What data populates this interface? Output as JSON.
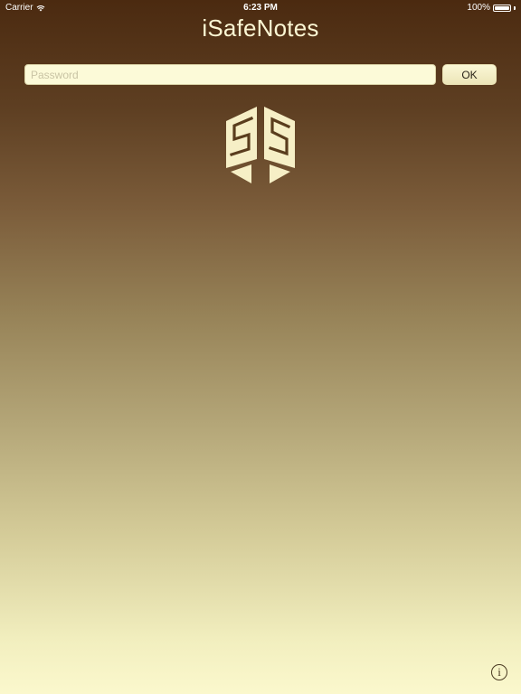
{
  "status_bar": {
    "carrier": "Carrier",
    "time": "6:23 PM",
    "battery_percent": "100%",
    "battery_level": 1.0,
    "wifi_icon": "wifi-icon",
    "battery_icon": "battery-icon"
  },
  "app": {
    "title": "iSafeNotes",
    "logo_icon": "isafenotes-logo"
  },
  "login": {
    "password_placeholder": "Password",
    "password_value": "",
    "ok_label": "OK"
  },
  "info": {
    "glyph": "i",
    "icon": "info-icon"
  },
  "colors": {
    "title_text": "#fbf6d3",
    "gradient_top": "#4b2a10",
    "gradient_bottom": "#fbf8cd",
    "input_background": "#fcfad8",
    "logo_fill": "#f6efc6"
  }
}
